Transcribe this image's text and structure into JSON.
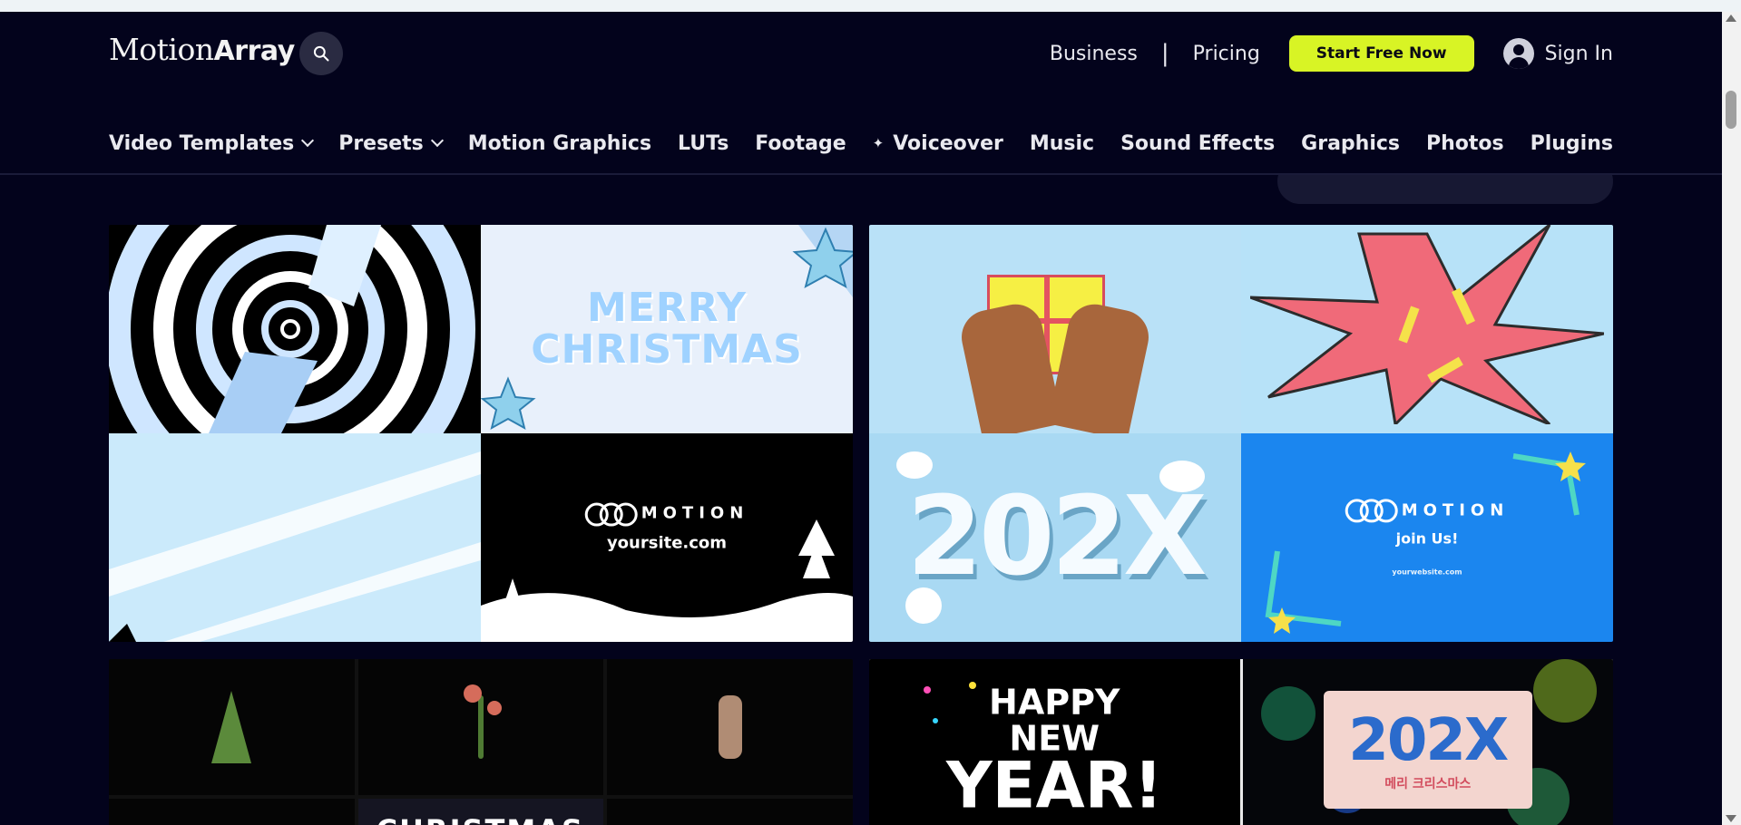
{
  "site": {
    "logo_light": "Motion",
    "logo_bold": "Array",
    "header": {
      "business": "Business",
      "separator": "|",
      "pricing": "Pricing",
      "start_free": "Start Free Now",
      "sign_in": "Sign In"
    },
    "nav": [
      {
        "label": "Video Templates",
        "has_dropdown": true
      },
      {
        "label": "Presets",
        "has_dropdown": true
      },
      {
        "label": "Motion Graphics"
      },
      {
        "label": "LUTs"
      },
      {
        "label": "Footage"
      },
      {
        "label": "Voiceover",
        "icon": "sparkle-icon"
      },
      {
        "label": "Music"
      },
      {
        "label": "Sound Effects"
      },
      {
        "label": "Graphics"
      },
      {
        "label": "Photos"
      },
      {
        "label": "Plugins"
      }
    ]
  },
  "cards": [
    {
      "tiles": [
        {
          "text": ""
        },
        {
          "text": "MERRY CHRISTMAS"
        },
        {
          "text": ""
        },
        {
          "brand": "MOTION",
          "url": "yoursite.com"
        }
      ]
    },
    {
      "tiles": [
        {
          "text": ""
        },
        {
          "text": ""
        },
        {
          "text": "202X"
        },
        {
          "brand": "MOTION",
          "tagline": "join Us!",
          "url": "yourwebsite.com"
        }
      ]
    },
    {
      "tiles": [
        {
          "text": ""
        },
        {
          "text": ""
        },
        {
          "text": ""
        },
        {
          "text": ""
        },
        {
          "text": "CHRISTMAS"
        },
        {
          "text": ""
        }
      ]
    },
    {
      "tiles": [
        {
          "text_line_1": "HAPPY NEW",
          "text_line_2": "YEAR!"
        },
        {
          "plaque_number": "202X",
          "plaque_korean": "메리 크리스마스"
        }
      ]
    }
  ],
  "colors": {
    "background": "#03031c",
    "accent_cta": "#d8f425",
    "text": "#e9e9ef"
  }
}
